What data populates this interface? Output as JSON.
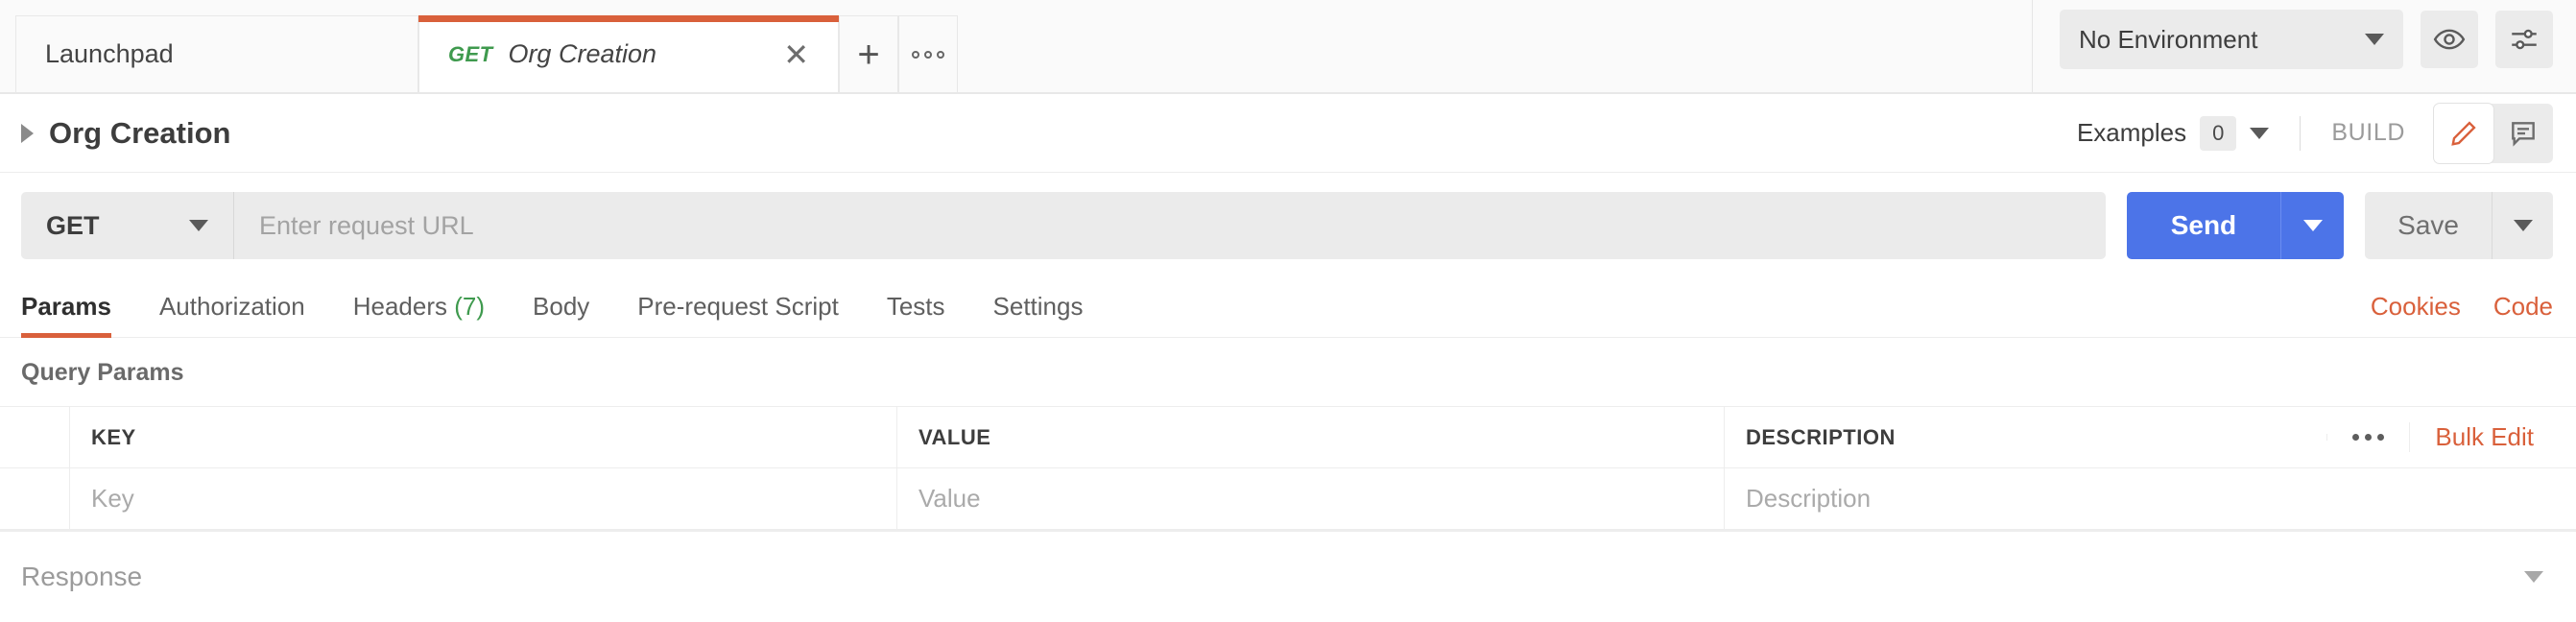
{
  "tabbar": {
    "tabs": [
      {
        "label": "Launchpad",
        "method": "",
        "active": false
      },
      {
        "label": "Org Creation",
        "method": "GET",
        "active": true
      }
    ],
    "close_glyph": "✕",
    "new_tab_label": "+",
    "tab_menu_label": "•••",
    "environment": {
      "selected": "No Environment"
    },
    "eye_icon": "eye-icon",
    "settings_icon": "sliders-icon"
  },
  "header": {
    "title": "Org Creation",
    "examples_label": "Examples",
    "examples_count": "0",
    "build_label": "BUILD",
    "edit_icon": "pencil-icon",
    "comment_icon": "comment-icon"
  },
  "request": {
    "method": "GET",
    "url_value": "",
    "url_placeholder": "Enter request URL",
    "send_label": "Send",
    "save_label": "Save"
  },
  "tabs": {
    "items": [
      {
        "label": "Params",
        "count": "",
        "active": true
      },
      {
        "label": "Authorization",
        "count": "",
        "active": false
      },
      {
        "label": "Headers",
        "count": "(7)",
        "active": false
      },
      {
        "label": "Body",
        "count": "",
        "active": false
      },
      {
        "label": "Pre-request Script",
        "count": "",
        "active": false
      },
      {
        "label": "Tests",
        "count": "",
        "active": false
      },
      {
        "label": "Settings",
        "count": "",
        "active": false
      }
    ],
    "cookies_label": "Cookies",
    "code_label": "Code"
  },
  "params": {
    "section_title": "Query Params",
    "columns": [
      "KEY",
      "VALUE",
      "DESCRIPTION"
    ],
    "rows": [
      {
        "key": "Key",
        "value": "Value",
        "description": "Description"
      }
    ],
    "more_label": "•••",
    "bulk_edit_label": "Bulk Edit"
  },
  "response": {
    "label": "Response"
  },
  "colors": {
    "accent_orange": "#d9603b",
    "send_blue": "#4c74e8",
    "method_green": "#3f9a4e",
    "panel_grey": "#ebebeb"
  }
}
